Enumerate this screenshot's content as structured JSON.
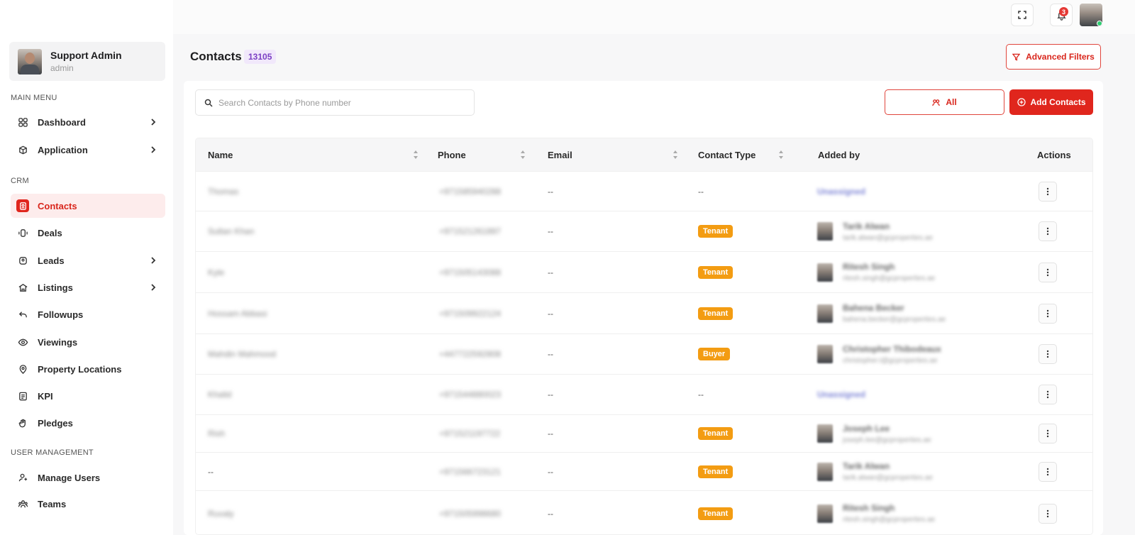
{
  "user": {
    "name": "Support Admin",
    "role": "admin"
  },
  "topbar": {
    "notification_count": "3"
  },
  "menu": {
    "main_section": "MAIN MENU",
    "crm_section": "CRM",
    "user_section": "USER MANAGEMENT",
    "items": [
      {
        "label": "Dashboard",
        "icon": "dashboard-icon"
      },
      {
        "label": "Application",
        "icon": "application-icon"
      },
      {
        "label": "Contacts",
        "icon": "contacts-icon"
      },
      {
        "label": "Deals",
        "icon": "deals-icon"
      },
      {
        "label": "Leads",
        "icon": "leads-icon"
      },
      {
        "label": "Listings",
        "icon": "listings-icon"
      },
      {
        "label": "Followups",
        "icon": "followups-icon"
      },
      {
        "label": "Viewings",
        "icon": "eye-icon"
      },
      {
        "label": "Property Locations",
        "icon": "location-pin-icon"
      },
      {
        "label": "KPI",
        "icon": "kpi-icon"
      },
      {
        "label": "Pledges",
        "icon": "hand-icon"
      },
      {
        "label": "Manage Users",
        "icon": "manage-users-icon"
      },
      {
        "label": "Teams",
        "icon": "teams-icon"
      }
    ]
  },
  "page": {
    "title": "Contacts",
    "count": "13105",
    "advanced_filters": "Advanced Filters",
    "search_placeholder": "Search Contacts by Phone number",
    "all_label": "All",
    "add_label": "Add Contacts"
  },
  "table": {
    "columns": [
      "Name",
      "Phone",
      "Email",
      "Contact Type",
      "Added by",
      "Actions"
    ],
    "rows": [
      {
        "name": "Thomas",
        "phone": "+971585940288",
        "email": "--",
        "type": "--",
        "added_by": "Unassigned",
        "added_email": ""
      },
      {
        "name": "Sultan Khan",
        "phone": "+971521261897",
        "email": "--",
        "type": "Tenant",
        "added_by": "Tarik Alwan",
        "added_email": "tarik.alwan@gcproperties.ae"
      },
      {
        "name": "Kyle",
        "phone": "+971505143088",
        "email": "--",
        "type": "Tenant",
        "added_by": "Ritesh Singh",
        "added_email": "ritesh.singh@gcproperties.ae"
      },
      {
        "name": "Hossam Abbasi",
        "phone": "+971509922124",
        "email": "--",
        "type": "Tenant",
        "added_by": "Bahena Becker",
        "added_email": "bahena.becker@gcproperties.ae"
      },
      {
        "name": "Mahdin Mahmood",
        "phone": "+447722592808",
        "email": "--",
        "type": "Buyer",
        "added_by": "Christopher Thibodeaux",
        "added_email": "christopher.t@gcproperties.ae"
      },
      {
        "name": "Khalid",
        "phone": "+971544880023",
        "email": "--",
        "type": "--",
        "added_by": "Unassigned",
        "added_email": ""
      },
      {
        "name": "Rish",
        "phone": "+971521197722",
        "email": "--",
        "type": "Tenant",
        "added_by": "Joseph Lee",
        "added_email": "joseph.lee@gcproperties.ae"
      },
      {
        "name": "--",
        "phone": "+971566723121",
        "email": "--",
        "type": "Tenant",
        "added_by": "Tarik Alwan",
        "added_email": "tarik.alwan@gcproperties.ae"
      },
      {
        "name": "Ruvaly",
        "phone": "+971505998680",
        "email": "--",
        "type": "Tenant",
        "added_by": "Ritesh Singh",
        "added_email": "ritesh.singh@gcproperties.ae"
      }
    ]
  }
}
